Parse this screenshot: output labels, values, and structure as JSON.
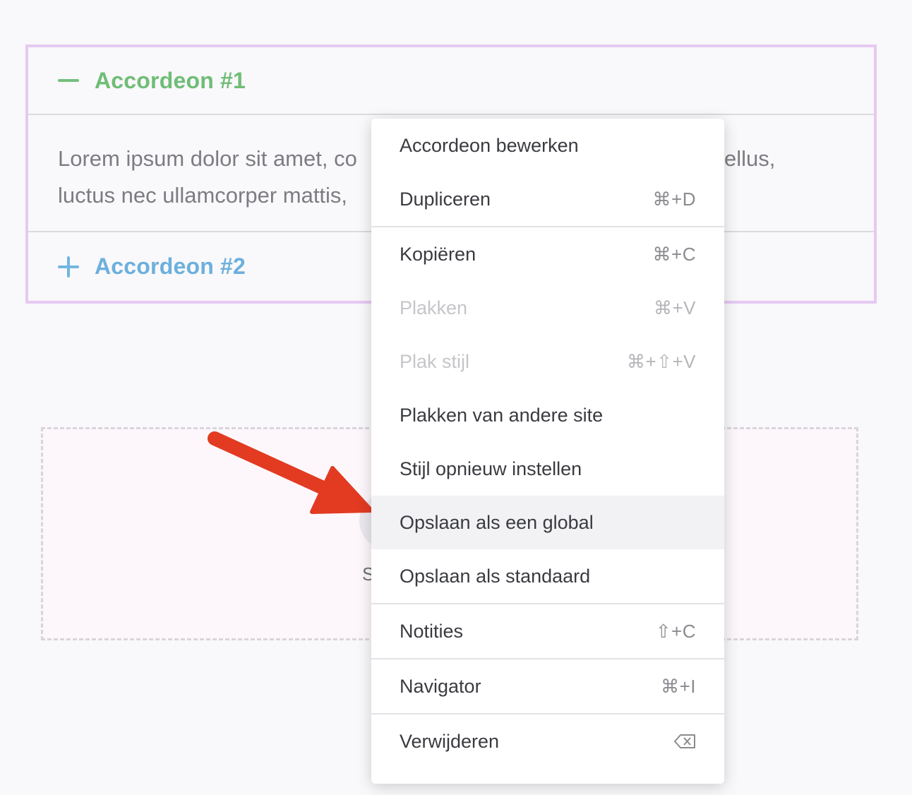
{
  "accordion": {
    "item1_title": "Accordeon #1",
    "item1_body_line1": "Lorem ipsum dolor sit amet, co",
    "item1_body_line1_right": "ellus,",
    "item1_body_line2": "luctus nec ullamcorper mattis,",
    "item2_title": "Accordeon #2",
    "item1_icon": "minus-icon",
    "item2_icon": "plus-icon",
    "title_color_open": "#6fbd77",
    "title_color_closed": "#6cb0dd"
  },
  "dropzone": {
    "partial_text": "S"
  },
  "context_menu": {
    "items": [
      {
        "label": "Accordeon bewerken",
        "shortcut": ""
      },
      {
        "label": "Dupliceren",
        "shortcut": "⌘+D"
      },
      {
        "label": "Kopiëren",
        "shortcut": "⌘+C"
      },
      {
        "label": "Plakken",
        "shortcut": "⌘+V",
        "disabled": true
      },
      {
        "label": "Plak stijl",
        "shortcut": "⌘+⇧+V",
        "disabled": true
      },
      {
        "label": "Plakken van andere site",
        "shortcut": ""
      },
      {
        "label": "Stijl opnieuw instellen",
        "shortcut": ""
      },
      {
        "label": "Opslaan als een global",
        "shortcut": "",
        "highlighted": true
      },
      {
        "label": "Opslaan als standaard",
        "shortcut": ""
      },
      {
        "label": "Notities",
        "shortcut": "⇧+C"
      },
      {
        "label": "Navigator",
        "shortcut": "⌘+I"
      },
      {
        "label": "Verwijderen",
        "shortcut_icon": "delete-key-icon"
      }
    ]
  },
  "annotation": {
    "arrow_color": "#e23b22",
    "arrow_icon": "red-arrow-icon"
  }
}
